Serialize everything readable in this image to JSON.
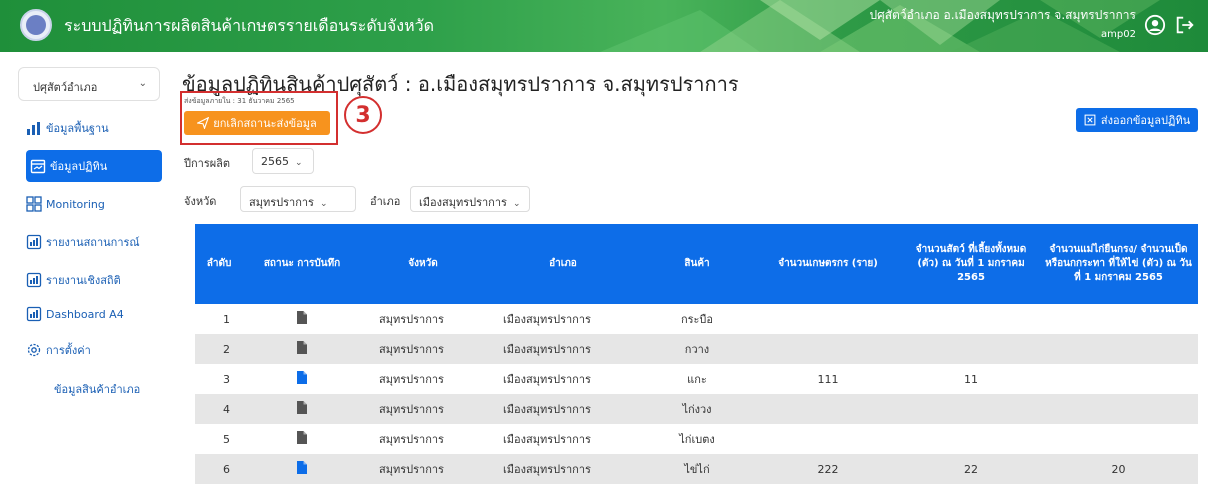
{
  "header": {
    "app_title": "ระบบปฏิทินการผลิตสินค้าเกษตรรายเดือนระดับจังหวัด",
    "user_name": "ปศุสัตว์อำเภอ อ.เมืองสมุทรปราการ จ.สมุทรปราการ",
    "user_id": "amp02"
  },
  "sidebar": {
    "role_select": "ปศุสัตว์อำเภอ",
    "items": [
      {
        "label": "ข้อมูลพื้นฐาน"
      },
      {
        "label": "ข้อมูลปฏิทิน"
      },
      {
        "label": "Monitoring"
      },
      {
        "label": "รายงานสถานการณ์"
      },
      {
        "label": "รายงานเชิงสถิติ"
      },
      {
        "label": "Dashboard A4"
      },
      {
        "label": "การตั้งค่า"
      }
    ],
    "sub_item": "ข้อมูลสินค้าอำเภอ"
  },
  "main": {
    "title": "ข้อมูลปฏิทินสินค้าปศุสัตว์ : อ.เมืองสมุทรปราการ จ.สมุทรปราการ",
    "send_date": "ส่งข้อมูลภายใน : 31 ธันวาคม 2565",
    "cancel_button": "ยกเลิกสถานะส่งข้อมูล",
    "step_number": "3",
    "export_button": "ส่งออกข้อมูลปฏิทิน",
    "year_label": "ปีการผลิต",
    "year_value": "2565",
    "province_label": "จังหวัด",
    "province_value": "สมุทรปราการ",
    "district_label": "อำเภอ",
    "district_value": "เมืองสมุทรปราการ"
  },
  "table": {
    "headers": [
      "ลำดับ",
      "สถานะ การบันทึก",
      "จังหวัด",
      "อำเภอ",
      "สินค้า",
      "จำนวนเกษตรกร (ราย)",
      "จำนวนสัตว์ ที่เลี้ยงทั้งหมด (ตัว) ณ วันที่ 1 มกราคม 2565",
      "จำนวนแม่ไก่ยืนกรง/ จำนวนเป็ดหรือนกกระทา ที่ให้ไข่ (ตัว) ณ วันที่ 1 มกราคม 2565"
    ],
    "rows": [
      {
        "no": "1",
        "status": "gray",
        "province": "สมุทรปราการ",
        "district": "เมืองสมุทรปราการ",
        "product": "กระบือ",
        "farmers": "",
        "animals": "",
        "layers": ""
      },
      {
        "no": "2",
        "status": "gray",
        "province": "สมุทรปราการ",
        "district": "เมืองสมุทรปราการ",
        "product": "กวาง",
        "farmers": "",
        "animals": "",
        "layers": ""
      },
      {
        "no": "3",
        "status": "blue",
        "province": "สมุทรปราการ",
        "district": "เมืองสมุทรปราการ",
        "product": "แกะ",
        "farmers": "111",
        "animals": "11",
        "layers": ""
      },
      {
        "no": "4",
        "status": "gray",
        "province": "สมุทรปราการ",
        "district": "เมืองสมุทรปราการ",
        "product": "ไก่งวง",
        "farmers": "",
        "animals": "",
        "layers": ""
      },
      {
        "no": "5",
        "status": "gray",
        "province": "สมุทรปราการ",
        "district": "เมืองสมุทรปราการ",
        "product": "ไก่เบตง",
        "farmers": "",
        "animals": "",
        "layers": ""
      },
      {
        "no": "6",
        "status": "blue",
        "province": "สมุทรปราการ",
        "district": "เมืองสมุทรปราการ",
        "product": "ไข่ไก่",
        "farmers": "222",
        "animals": "22",
        "layers": "20"
      }
    ]
  },
  "colors": {
    "header_green": "#2ea04a",
    "primary_blue": "#0d6de8",
    "orange": "#f7931e",
    "annotation_red": "#d32f2f",
    "doc_gray": "#555555",
    "doc_blue": "#0d6de8"
  }
}
